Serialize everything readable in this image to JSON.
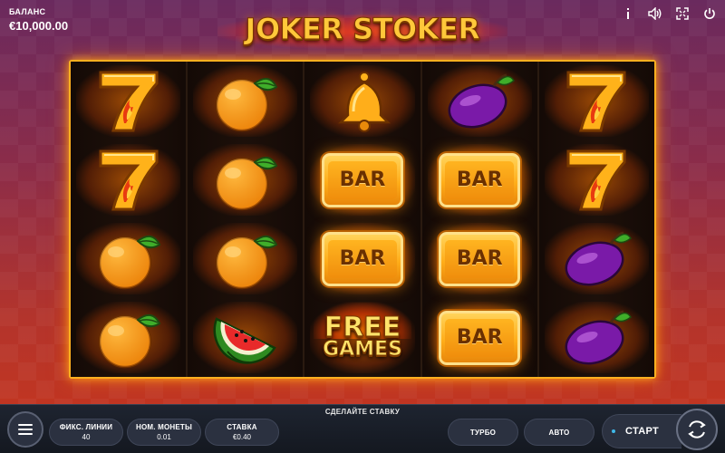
{
  "game": {
    "title": "JOKER STOKER"
  },
  "balance": {
    "label": "БАЛАНС",
    "value": "€10,000.00"
  },
  "top_controls": [
    {
      "name": "info-icon",
      "glyph": "i"
    },
    {
      "name": "sound-icon",
      "glyph": "◁)"
    },
    {
      "name": "fullscreen-icon",
      "glyph": "⛶"
    },
    {
      "name": "power-icon",
      "glyph": "⏻"
    }
  ],
  "reels": [
    [
      "seven",
      "seven",
      "orange",
      "orange"
    ],
    [
      "orange",
      "orange",
      "orange",
      "watermelon"
    ],
    [
      "bell",
      "bar",
      "bar",
      "free-games"
    ],
    [
      "plum",
      "bar",
      "bar",
      "bar"
    ],
    [
      "seven",
      "seven",
      "plum",
      "plum"
    ]
  ],
  "symbols": {
    "bar_text": "BAR",
    "free_games_line1": "FREE",
    "free_games_line2": "GAMES"
  },
  "bottom_bar": {
    "prompt": "СДЕЛАЙТЕ СТАВКУ",
    "fixed_lines": {
      "label": "ФИКС. ЛИНИИ",
      "value": "40"
    },
    "coin_value": {
      "label": "НОМ. МОНЕТЫ",
      "value": "0.01"
    },
    "bet": {
      "label": "СТАВКА",
      "value": "€0.40"
    },
    "turbo_label": "ТУРБО",
    "auto_label": "АВТО",
    "start_label": "СТАРТ"
  },
  "colors": {
    "accent_gold": "#ffb020",
    "start_indicator": "#3fb8e8"
  }
}
